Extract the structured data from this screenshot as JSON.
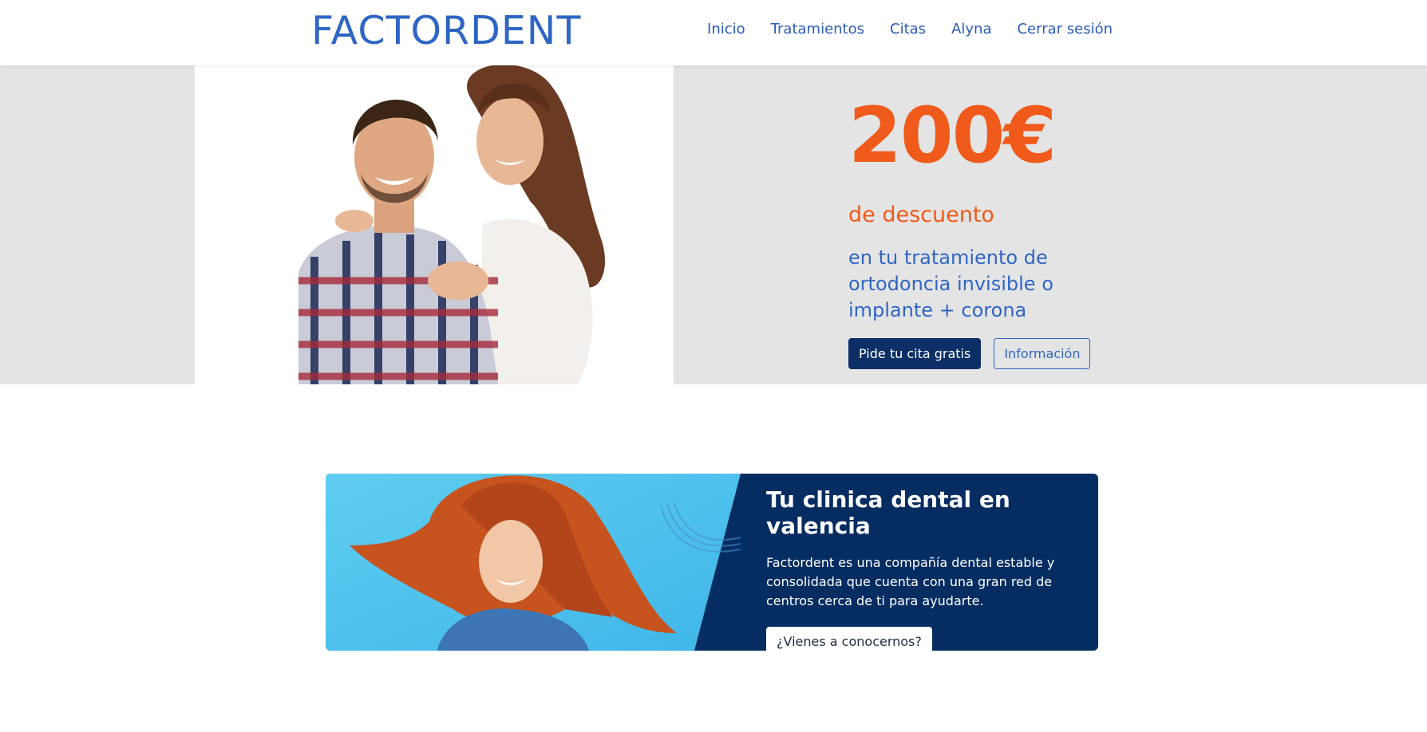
{
  "header": {
    "logo": "FACTORDENT",
    "nav": [
      "Inicio",
      "Tratamientos",
      "Citas",
      "Alyna",
      "Cerrar sesión"
    ]
  },
  "hero": {
    "price": "200€",
    "discount": "de descuento",
    "treatment": "en tu tratamiento de ortodoncia invisible o implante + corona",
    "primary_button": "Pide tu cita gratis",
    "secondary_button": "Información"
  },
  "banner": {
    "title": "Tu clinica dental en valencia",
    "description": "Factordent es una compañía dental estable y consolidada que cuenta con una gran red de centros cerca de ti para ayudarte.",
    "button": "¿Vienes a conocernos?"
  },
  "colors": {
    "brand_blue": "#2f66c4",
    "navy": "#0b2f66",
    "orange": "#f05a1a",
    "hero_bg": "#e4e4e4"
  }
}
